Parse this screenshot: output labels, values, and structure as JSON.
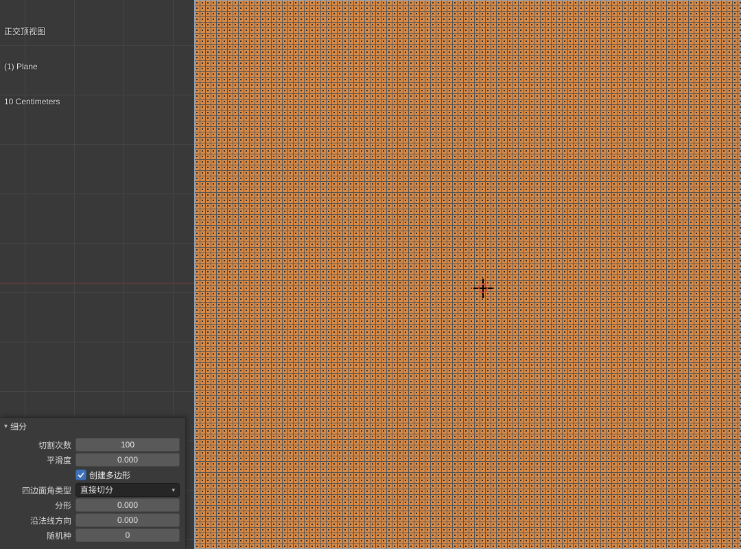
{
  "overlay": {
    "view_name": "正交顶视图",
    "object_name": "(1) Plane",
    "scale_text": "10 Centimeters"
  },
  "operator_panel": {
    "title": "细分",
    "rows": {
      "cuts_label": "切割次数",
      "cuts_value": "100",
      "smooth_label": "平滑度",
      "smooth_value": "0.000",
      "ngon_label": "创建多边形",
      "ngon_checked": true,
      "quadcorner_label": "四边面角类型",
      "quadcorner_value": "直接切分",
      "fractal_label": "分形",
      "fractal_value": "0.000",
      "along_normal_label": "沿法线方向",
      "along_normal_value": "0.000",
      "seed_label": "随机种",
      "seed_value": "0"
    }
  }
}
